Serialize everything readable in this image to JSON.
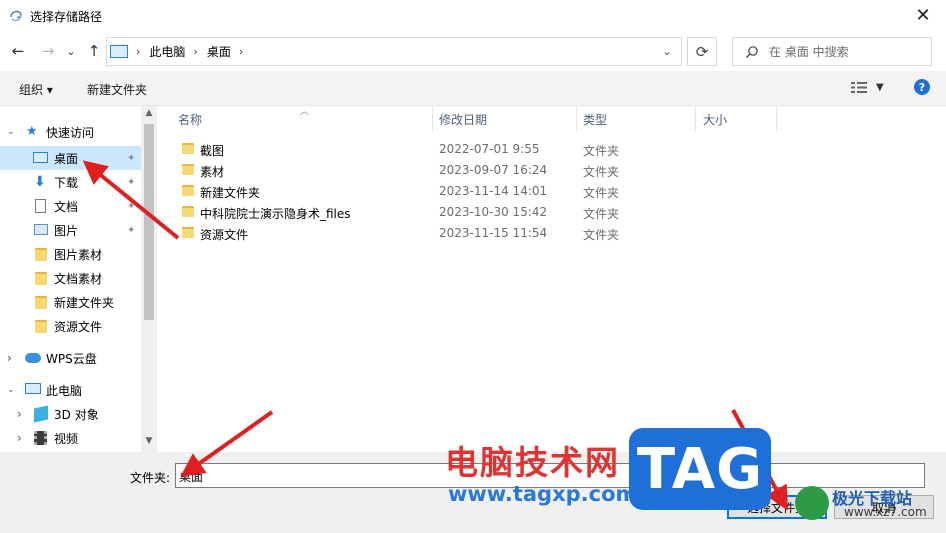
{
  "window": {
    "title": "选择存储路径",
    "close_glyph": "✕"
  },
  "nav": {
    "back_glyph": "←",
    "forward_glyph": "→",
    "recent_glyph": "⌄",
    "up_glyph": "↑",
    "breadcrumb": [
      "此电脑",
      "桌面"
    ],
    "crumb_sep": "›",
    "refresh_glyph": "⟳",
    "search_placeholder": "在 桌面 中搜索"
  },
  "toolbar": {
    "organize_label": "组织 ▾",
    "new_folder_label": "新建文件夹",
    "help_label": "?"
  },
  "sidebar": {
    "items": [
      {
        "label": "快速访问",
        "icon": "star-icon",
        "expander": "⌄"
      },
      {
        "label": "桌面",
        "icon": "desktop-icon",
        "pinned": true
      },
      {
        "label": "下载",
        "icon": "download-icon",
        "pinned": true
      },
      {
        "label": "文档",
        "icon": "document-icon",
        "pinned": true
      },
      {
        "label": "图片",
        "icon": "picture-icon",
        "pinned": true
      },
      {
        "label": "图片素材",
        "icon": "folder-icon"
      },
      {
        "label": "文档素材",
        "icon": "folder-icon"
      },
      {
        "label": "新建文件夹",
        "icon": "folder-icon"
      },
      {
        "label": "资源文件",
        "icon": "folder-icon"
      },
      {
        "label": "WPS云盘",
        "icon": "cloud-icon",
        "expander": "›"
      },
      {
        "label": "此电脑",
        "icon": "computer-icon",
        "expander": "⌄"
      },
      {
        "label": "3D 对象",
        "icon": "3d-objects-icon",
        "expander": "›"
      },
      {
        "label": "视频",
        "icon": "video-icon",
        "expander": "›"
      }
    ],
    "pin_glyph": "📌"
  },
  "list": {
    "columns": [
      "名称",
      "修改日期",
      "类型",
      "大小"
    ],
    "rows": [
      {
        "name": "截图",
        "date": "2022-07-01 9:55",
        "type": "文件夹"
      },
      {
        "name": "素材",
        "date": "2023-09-07 16:24",
        "type": "文件夹"
      },
      {
        "name": "新建文件夹",
        "date": "2023-11-14 14:01",
        "type": "文件夹"
      },
      {
        "name": "中科院院士演示隐身术_files",
        "date": "2023-10-30 15:42",
        "type": "文件夹"
      },
      {
        "name": "资源文件",
        "date": "2023-11-15 11:54",
        "type": "文件夹"
      }
    ]
  },
  "footer": {
    "folder_label": "文件夹:",
    "folder_value": "桌面",
    "select_button": "选择文件夹",
    "cancel_button": "取消"
  },
  "watermark": {
    "site_name": "电脑技术网",
    "site_url": "www.tagxp.com",
    "badge": "TAG",
    "logo_name": "极光下载站",
    "logo_url": "www.xz7.com"
  },
  "colors": {
    "accent": "#0078d7",
    "selection": "#cce8ff",
    "annotation_arrow": "#e02020"
  }
}
